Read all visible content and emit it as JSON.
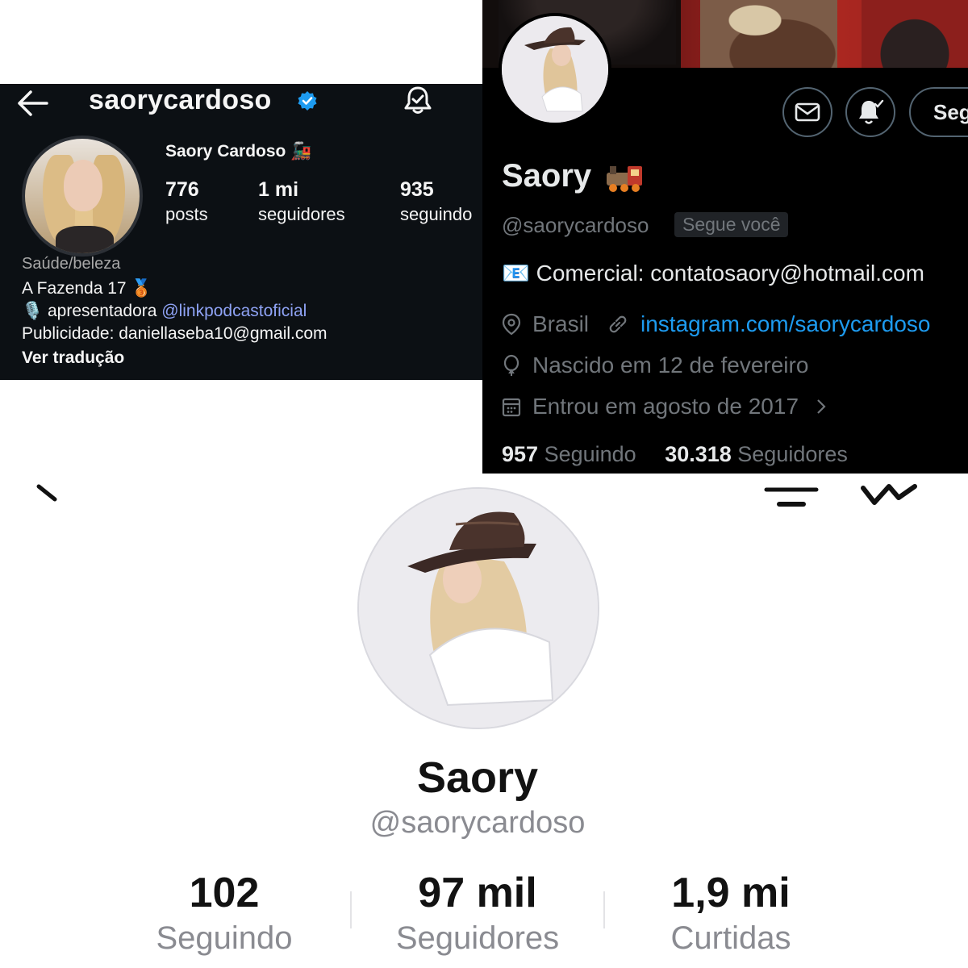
{
  "instagram": {
    "username": "saorycardoso",
    "display_name": "Saory Cardoso 🚂",
    "stats": [
      {
        "value": "776",
        "label": "posts"
      },
      {
        "value": "1 mi",
        "label": "seguidores"
      },
      {
        "value": "935",
        "label": "seguindo"
      }
    ],
    "category": "Saúde/beleza",
    "bio_line1": "A Fazenda 17 🥉",
    "bio_line2_prefix": "🎙️ apresentadora ",
    "bio_line2_mention": "@linkpodcastoficial",
    "bio_line3": "Publicidade: daniellaseba10@gmail.com",
    "translate": "Ver tradução"
  },
  "twitter": {
    "follow_button": "Seg",
    "name": "Saory",
    "handle": "@saorycardoso",
    "follows_you": "Segue você",
    "bio": "📧 Comercial: contatosaory@hotmail.com",
    "location": "Brasil",
    "link": "instagram.com/saorycardoso",
    "birthday": "Nascido em 12 de fevereiro",
    "joined": "Entrou em agosto de 2017",
    "following_count": "957",
    "following_label": " Seguindo",
    "followers_count": "30.318",
    "followers_label": " Seguidores"
  },
  "tiktok": {
    "name": "Saory",
    "handle": "@saorycardoso",
    "stats": [
      {
        "value": "102",
        "label": "Seguindo"
      },
      {
        "value": "97 mil",
        "label": "Seguidores"
      },
      {
        "value": "1,9 mi",
        "label": "Curtidas"
      }
    ]
  },
  "colors": {
    "instagram_bg": "#0c1014",
    "twitter_bg": "#000000",
    "twitter_link": "#1d9bf0",
    "instagram_mention": "#8fa3f5",
    "verified_blue": "#1d9bf0"
  }
}
